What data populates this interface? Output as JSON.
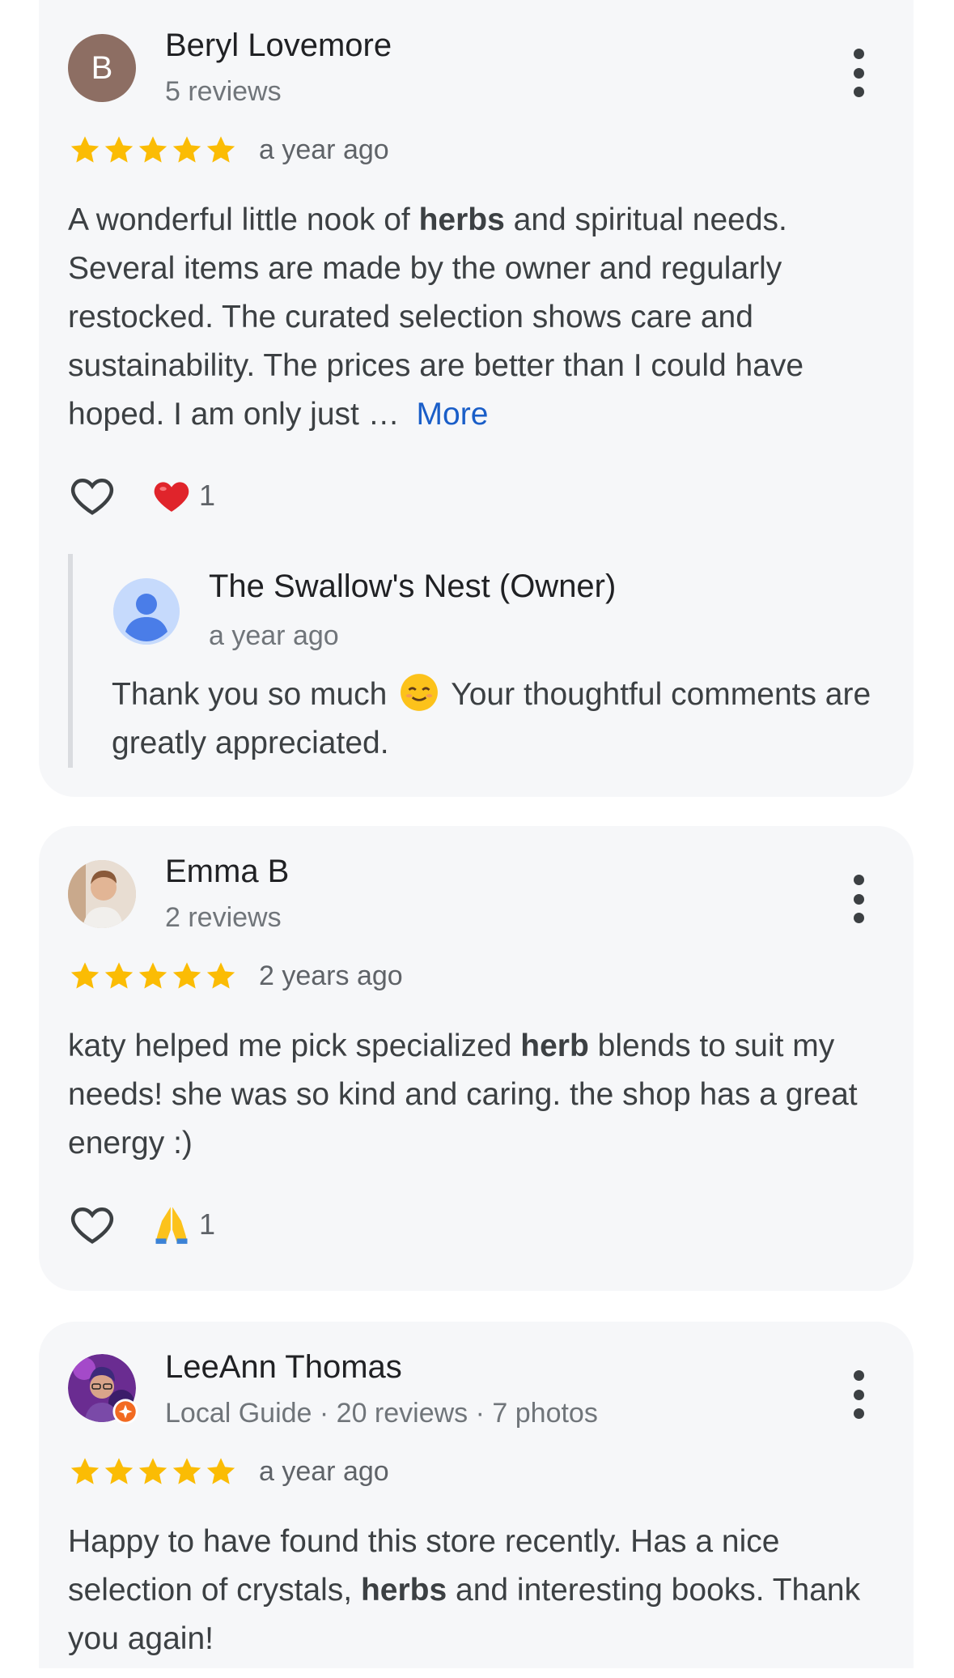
{
  "reviews": [
    {
      "author": "Beryl Lovemore",
      "avatar_letter": "B",
      "subtitle": "5 reviews",
      "rating": 5,
      "time": "a year ago",
      "text_before": "A wonderful little nook of ",
      "text_bold": "herbs",
      "text_after": " and spiritual needs. Several items are made by the owner and regularly restocked. The curated selection shows care and sustainability. The prices are better than I could have hoped. I am only just … ",
      "more_label": "More",
      "reaction_emoji": "heart-emoji",
      "reaction_count": "1",
      "owner_reply": {
        "name": "The Swallow's Nest (Owner)",
        "time": "a year ago",
        "text_before": "Thank you so much ",
        "text_after": " Your thoughtful comments are greatly appreciated."
      }
    },
    {
      "author": "Emma B",
      "subtitle": "2 reviews",
      "rating": 5,
      "time": "2 years ago",
      "text_before": "katy helped me pick specialized ",
      "text_bold": "herb",
      "text_after": " blends to suit my needs! she was so kind and caring. the shop has a great energy :)",
      "reaction_emoji": "folded-hands-emoji",
      "reaction_count": "1"
    },
    {
      "author": "LeeAnn Thomas",
      "subtitle": "Local Guide · 20 reviews · 7 photos",
      "rating": 5,
      "time": "a year ago",
      "text_before": "Happy to have found this store recently. Has a nice selection of crystals, ",
      "text_bold": "herbs",
      "text_after": " and interesting books. Thank you again!"
    }
  ],
  "colors": {
    "card_bg": "#f6f7f9",
    "star": "#fbbc04",
    "link": "#1a5ec8",
    "avatar_letter_bg": "#8d6e63"
  }
}
